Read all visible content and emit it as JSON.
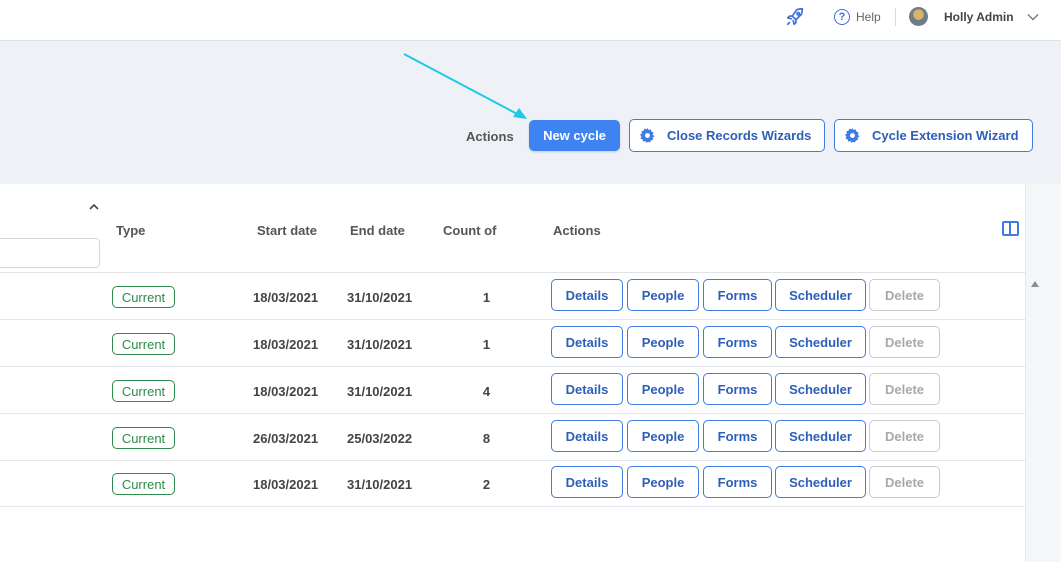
{
  "topbar": {
    "help_label": "Help",
    "help_glyph": "?",
    "user_name": "Holly Admin",
    "icons": [
      "rocket-icon",
      "help-circle-icon",
      "avatar",
      "chevron-down-icon"
    ]
  },
  "toolbar": {
    "actions_label": "Actions",
    "new_cycle_label": "New cycle",
    "close_records_label": "Close Records Wizards",
    "cycle_extension_label": "Cycle Extension Wizard"
  },
  "table": {
    "headers": {
      "type": "Type",
      "start_date": "Start date",
      "end_date": "End date",
      "count_of": "Count of",
      "actions": "Actions"
    },
    "filter_placeholder": "",
    "row_actions": {
      "details": "Details",
      "people": "People",
      "forms": "Forms",
      "scheduler": "Scheduler",
      "delete": "Delete"
    },
    "rows": [
      {
        "type": "Current",
        "start": "18/03/2021",
        "end": "31/10/2021",
        "count": "1"
      },
      {
        "type": "Current",
        "start": "18/03/2021",
        "end": "31/10/2021",
        "count": "1"
      },
      {
        "type": "Current",
        "start": "18/03/2021",
        "end": "31/10/2021",
        "count": "4"
      },
      {
        "type": "Current",
        "start": "26/03/2021",
        "end": "25/03/2022",
        "count": "8"
      },
      {
        "type": "Current",
        "start": "18/03/2021",
        "end": "31/10/2021",
        "count": "2"
      }
    ]
  },
  "colors": {
    "primary": "#3f82f2",
    "outline_blue": "#3f7be0",
    "status_green": "#2e8b4a",
    "annotation_arrow": "#1ec9e8",
    "page_bg": "#eef2f7"
  }
}
